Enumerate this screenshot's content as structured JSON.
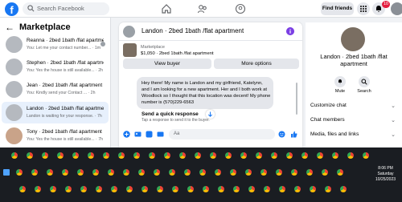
{
  "topbar": {
    "logo": "f",
    "search_placeholder": "Search Facebook",
    "find_friends": "Find friends",
    "notif_count": "10",
    "icons": [
      "home-icon",
      "people-icon",
      "groups-icon",
      "apps-grid-icon",
      "messenger-icon",
      "bell-icon"
    ]
  },
  "marketplace": {
    "title": "Marketplace",
    "conversations": [
      {
        "name": "Reanna · 2bed 1bath /flat apartment",
        "snippet": "You: Let me your contact number... · 1m"
      },
      {
        "name": "Stephen · 2bed 1bath /flat apartment",
        "snippet": "You: Yes the house is still available... · 2h"
      },
      {
        "name": "Jean · 2bed 1bath /flat apartment",
        "snippet": "You: Kindly send your Contact ... · 2h"
      },
      {
        "name": "Landon · 2bed 1bath /flat apartment",
        "snippet": "Landon is waiting for your response. · 7h"
      },
      {
        "name": "Tony · 2bed 1bath /flat apartment",
        "snippet": "You: Yes the house is still available... · 7h"
      }
    ]
  },
  "chat": {
    "title": "Landon · 2bed 1bath /flat apartment",
    "listing_source": "Marketplace",
    "listing_line": "$1,050 · 2bed 1bath /flat apartment",
    "view_buyer": "View buyer",
    "more_options": "More options",
    "message": "Hey there! My name is Landon and my girlfriend, Katelynn, and I am looking for a new apartment. Her and I both work at Woodlock so I thought that this location was decent! My phone number is (570)229-6563",
    "quick_title": "Send a quick response",
    "quick_sub": "Tap a response to send it to the buyer.",
    "composer_placeholder": "Aa"
  },
  "details": {
    "name": "Landon · 2bed 1bath /flat apartment",
    "mute": "Mute",
    "search": "Search",
    "rows": [
      "Customize chat",
      "Chat members",
      "Media, files and links"
    ]
  },
  "taskbar": {
    "time": "8:06 PM",
    "day": "Saturday",
    "date": "10/25/2023"
  },
  "colors": {
    "accent": "#1877f2",
    "badge": "#e41e3f"
  }
}
